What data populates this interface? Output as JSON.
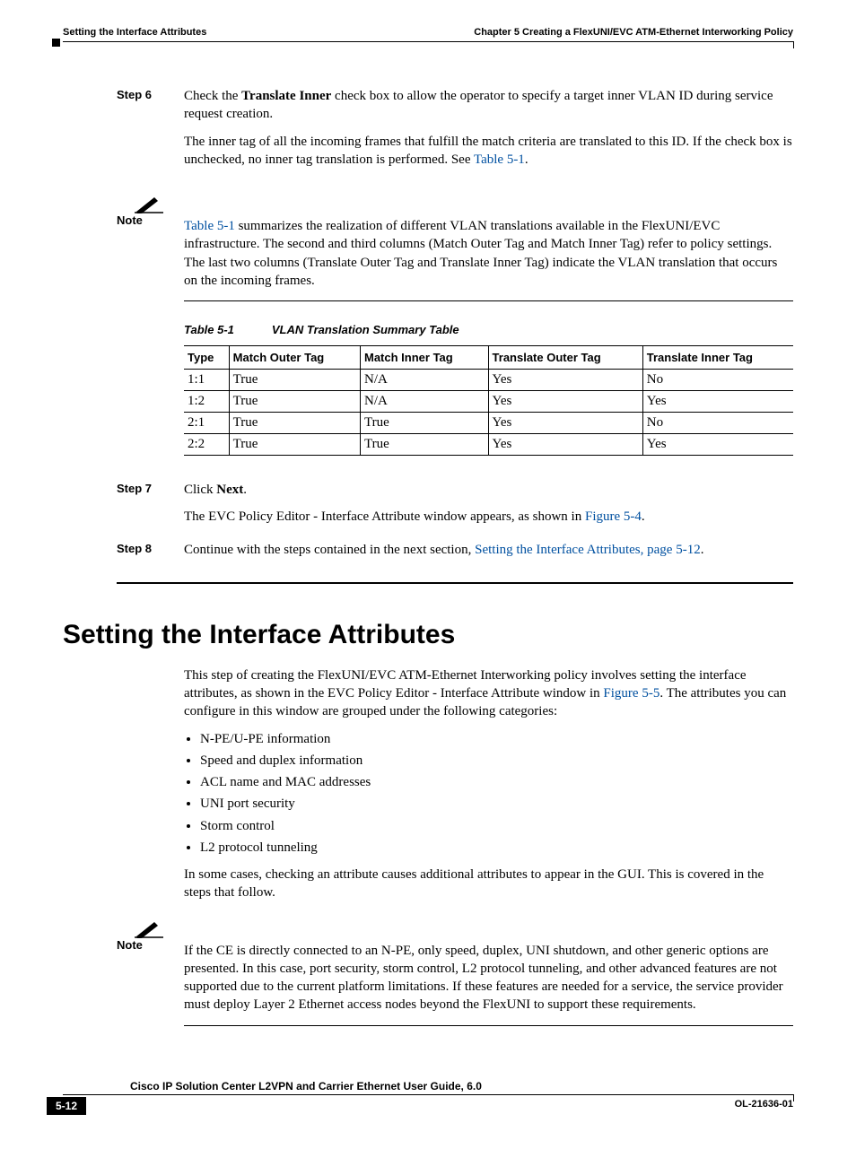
{
  "header": {
    "chapter": "Chapter 5      Creating a FlexUNI/EVC ATM-Ethernet Interworking Policy",
    "section": "Setting the Interface Attributes"
  },
  "steps": {
    "s6": {
      "label": "Step 6",
      "p1_a": "Check the ",
      "p1_b": "Translate Inner",
      "p1_c": " check box to allow the operator to specify a target inner VLAN ID during service request creation.",
      "p2_a": "The inner tag of all the incoming frames that fulfill the match criteria are translated to this ID. If the check box is unchecked, no inner tag translation is performed. See ",
      "p2_link": "Table 5-1",
      "p2_b": "."
    },
    "s7": {
      "label": "Step 7",
      "p1_a": "Click ",
      "p1_b": "Next",
      "p1_c": ".",
      "p2_a": "The EVC Policy Editor - Interface Attribute window appears, as shown in ",
      "p2_link": "Figure 5-4",
      "p2_b": "."
    },
    "s8": {
      "label": "Step 8",
      "p1_a": "Continue with the steps contained in the next section, ",
      "p1_link": "Setting the Interface Attributes, page 5-12",
      "p1_b": "."
    }
  },
  "note1": {
    "label": "Note",
    "text_a": "",
    "link": "Table 5-1",
    "text_b": " summarizes the realization of different VLAN translations available in the FlexUNI/EVC infrastructure. The second and third columns (Match Outer Tag and Match Inner Tag) refer to policy settings. The last two columns (Translate Outer Tag and Translate Inner Tag) indicate the VLAN translation that occurs on the incoming frames."
  },
  "table": {
    "caption_num": "Table 5-1",
    "caption_title": "VLAN Translation Summary Table",
    "headers": [
      "Type",
      "Match Outer Tag",
      "Match Inner Tag",
      "Translate Outer Tag",
      "Translate Inner Tag"
    ],
    "rows": [
      [
        "1:1",
        "True",
        "N/A",
        "Yes",
        "No"
      ],
      [
        "1:2",
        "True",
        "N/A",
        "Yes",
        "Yes"
      ],
      [
        "2:1",
        "True",
        "True",
        "Yes",
        "No"
      ],
      [
        "2:2",
        "True",
        "True",
        "Yes",
        "Yes"
      ]
    ]
  },
  "section2": {
    "title": "Setting the Interface Attributes",
    "intro_a": "This step of creating the FlexUNI/EVC ATM-Ethernet Interworking policy involves setting the interface attributes, as shown in the EVC Policy Editor - Interface Attribute window in ",
    "intro_link": "Figure 5-5",
    "intro_b": ". The attributes you can configure in this window are grouped under the following categories:",
    "bullets": [
      "N-PE/U-PE information",
      "Speed and duplex information",
      "ACL name and MAC addresses",
      "UNI port security",
      "Storm control",
      "L2 protocol tunneling"
    ],
    "after": "In some cases, checking an attribute causes additional attributes to appear in the GUI. This is covered in the steps that follow."
  },
  "note2": {
    "label": "Note",
    "text": "If the CE is directly connected to an N-PE, only speed, duplex, UNI shutdown, and other generic options are presented. In this case, port security, storm control, L2 protocol tunneling, and other advanced features are not supported due to the current platform limitations. If these features are needed for a service, the service provider must deploy Layer 2 Ethernet access nodes beyond the FlexUNI to support these requirements."
  },
  "footer": {
    "book": "Cisco IP Solution Center L2VPN and Carrier Ethernet User Guide, 6.0",
    "page": "5-12",
    "docid": "OL-21636-01"
  }
}
